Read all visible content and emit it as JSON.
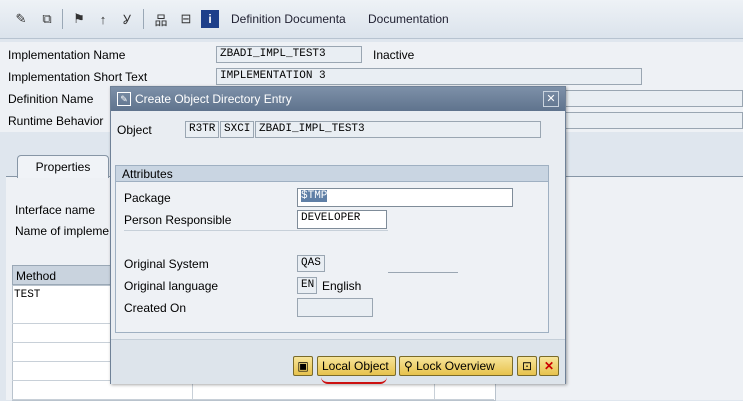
{
  "toolbar": {
    "definition_documentation": "Definition Documenta",
    "documentation": "Documentation"
  },
  "header": {
    "impl_name_label": "Implementation Name",
    "impl_name_value": "ZBADI_IMPL_TEST3",
    "status": "Inactive",
    "short_text_label": "Implementation Short Text",
    "short_text_value": "IMPLEMENTATION 3",
    "definition_name_label": "Definition Name",
    "runtime_behavior_label": "Runtime Behavior"
  },
  "tabs": {
    "properties": "Properties"
  },
  "properties": {
    "interface_name_label": "Interface name",
    "name_of_impl_label": "Name of impleme"
  },
  "methods": {
    "column_header": "Method",
    "rows": [
      "TEST"
    ]
  },
  "dialog": {
    "title": "Create Object Directory Entry",
    "object_label": "Object",
    "object_pgmid": "R3TR",
    "object_type": "SXCI",
    "object_name": "ZBADI_IMPL_TEST3",
    "attributes_title": "Attributes",
    "package_label": "Package",
    "package_value": "$TMP",
    "person_label": "Person Responsible",
    "person_value": "DEVELOPER",
    "original_system_label": "Original System",
    "original_system_value": "QAS",
    "original_language_label": "Original language",
    "original_language_code": "EN",
    "original_language_name": "English",
    "created_on_label": "Created On",
    "created_on_value": "",
    "local_object_button": "Local Object",
    "lock_overview_button": "Lock Overview"
  },
  "colors": {
    "dialog_title_bg": "#5f738d",
    "button_bg": "#e7c24d",
    "underline_annotation": "#cc1111"
  }
}
